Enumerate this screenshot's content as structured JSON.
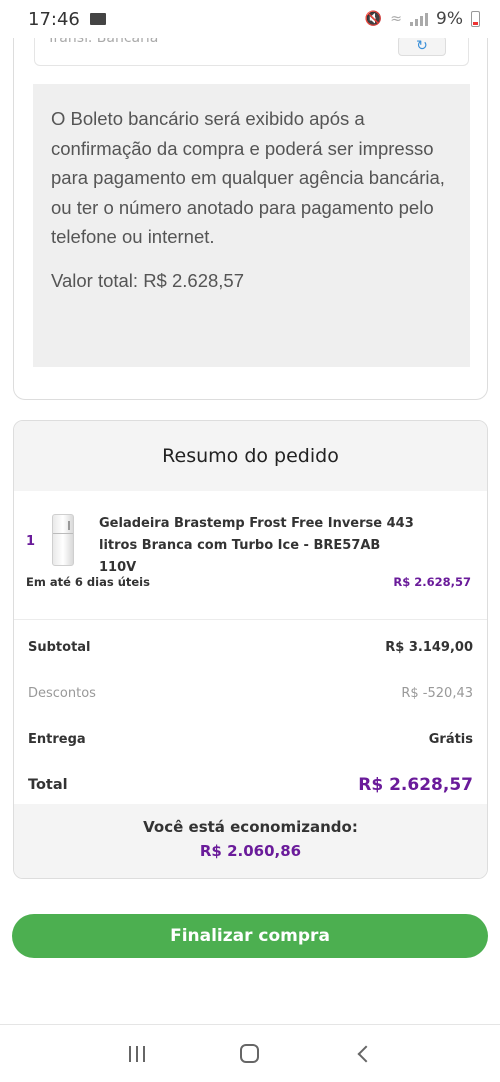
{
  "status_bar": {
    "time": "17:46",
    "battery": "9%"
  },
  "payment": {
    "method_label": "Transf. Bancária",
    "method_icon": "refresh-icon",
    "info_text": "O Boleto bancário será exibido após a confirmação da compra e poderá ser impresso para pagamento em qualquer agência bancária, ou ter o número anotado para pagamento pelo telefone ou internet.",
    "total_text": "Valor total: R$ 2.628,57"
  },
  "summary": {
    "title": "Resumo do pedido",
    "product": {
      "quantity": "1",
      "name": "Geladeira Brastemp Frost Free Inverse 443 litros Branca com Turbo Ice - BRE57AB 110V",
      "delivery": "Em até 6 dias úteis",
      "price": "R$ 2.628,57"
    },
    "rows": {
      "subtotal_label": "Subtotal",
      "subtotal_value": "R$ 3.149,00",
      "discount_label": "Descontos",
      "discount_value": "R$ -520,43",
      "delivery_label": "Entrega",
      "delivery_value": "Grátis",
      "total_label": "Total",
      "total_value": "R$ 2.628,57"
    },
    "savings_label": "Você está economizando:",
    "savings_value": "R$ 2.060,86"
  },
  "actions": {
    "finalize_label": "Finalizar compra"
  },
  "colors": {
    "accent_purple": "#6a1b9a",
    "button_green": "#4caf50"
  }
}
